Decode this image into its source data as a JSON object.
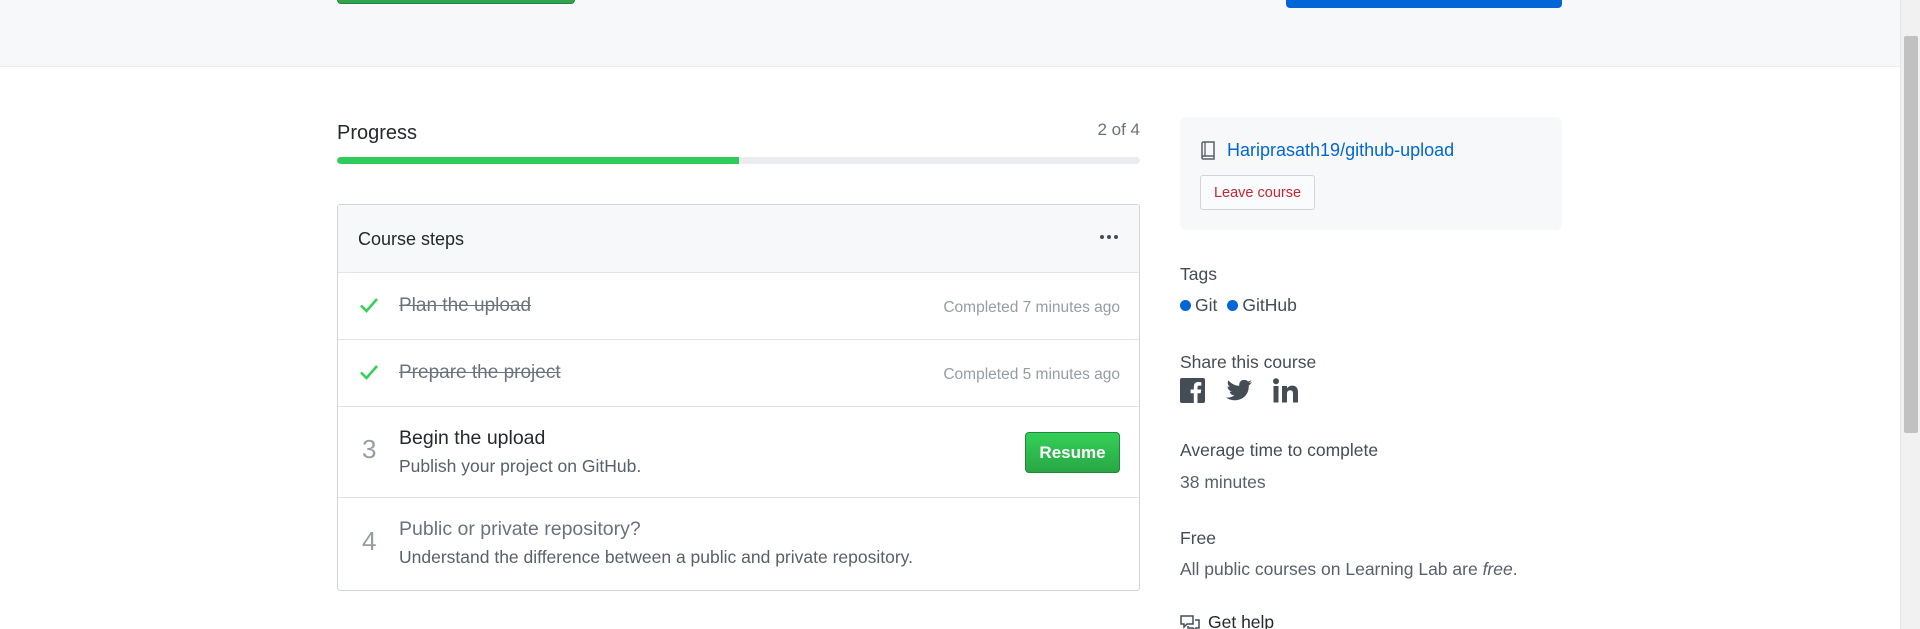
{
  "progress": {
    "title": "Progress",
    "count": "2 of 4",
    "fraction": 0.5
  },
  "steps": {
    "header": "Course steps",
    "items": [
      {
        "status": "completed",
        "title": "Plan the upload",
        "time": "Completed 7 minutes ago"
      },
      {
        "status": "completed",
        "title": "Prepare the project",
        "time": "Completed 5 minutes ago"
      },
      {
        "status": "current",
        "number": "3",
        "title": "Begin the upload",
        "description": "Publish your project on GitHub.",
        "button": "Resume"
      },
      {
        "status": "locked",
        "number": "4",
        "title": "Public or private repository?",
        "description": "Understand the difference between a public and private repository."
      }
    ]
  },
  "sidebar": {
    "repo": "Hariprasath19/github-upload",
    "leave_button": "Leave course",
    "tags_heading": "Tags",
    "tags": [
      "Git",
      "GitHub"
    ],
    "share_heading": "Share this course",
    "share_icons": [
      "facebook-icon",
      "twitter-icon",
      "linkedin-icon"
    ],
    "avg_heading": "Average time to complete",
    "avg_value": "38 minutes",
    "free_heading": "Free",
    "free_text_prefix": "All public courses on Learning Lab are ",
    "free_text_em": "free",
    "free_text_suffix": ".",
    "help_label": "Get help"
  },
  "colors": {
    "progress_fill": "#2ecc5a",
    "link": "#0366d6",
    "resume_button": "#28a745",
    "danger": "#cb2431",
    "tag_dot": "#0366d6"
  }
}
